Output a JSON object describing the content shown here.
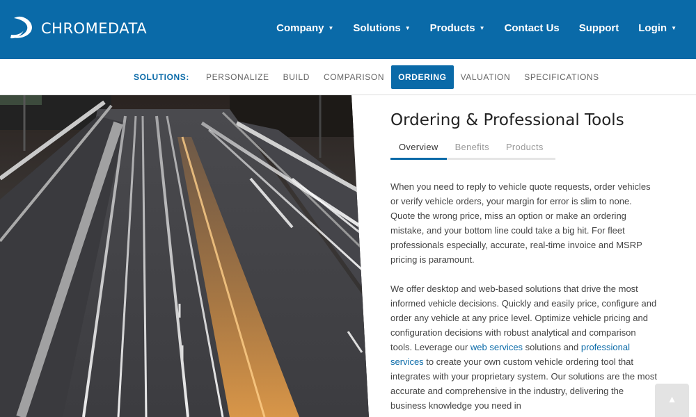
{
  "brand": {
    "name": "CHROMEDATA",
    "logo_icon": "chromedata-swoosh-logo",
    "primary_color": "#0a6aa8"
  },
  "nav": {
    "items": [
      {
        "label": "Company",
        "dropdown": true
      },
      {
        "label": "Solutions",
        "dropdown": true
      },
      {
        "label": "Products",
        "dropdown": true
      },
      {
        "label": "Contact Us",
        "dropdown": false
      },
      {
        "label": "Support",
        "dropdown": false
      },
      {
        "label": "Login",
        "dropdown": true
      }
    ],
    "caret": "▼"
  },
  "subnav": {
    "label": "SOLUTIONS:",
    "items": [
      "PERSONALIZE",
      "BUILD",
      "COMPARISON",
      "ORDERING",
      "VALUATION",
      "SPECIFICATIONS"
    ],
    "active": "ORDERING"
  },
  "main": {
    "title": "Ordering & Professional Tools",
    "tabs": [
      "Overview",
      "Benefits",
      "Products"
    ],
    "active_tab": "Overview",
    "p1": "When you need to reply to vehicle quote requests, order vehicles or verify vehicle orders, your margin for error is slim to none. Quote the wrong price, miss an option or make an ordering mistake, and your bottom line could take a big hit. For fleet professionals especially, accurate, real-time invoice and MSRP pricing is paramount.",
    "p2_a": "We offer desktop and web-based solutions that drive the most informed vehicle decisions. Quickly and easily price, configure and order any vehicle at any price level. Optimize vehicle pricing and configuration decisions with robust analytical and comparison tools. Leverage our ",
    "p2_link1": "web services",
    "p2_b": " solutions and ",
    "p2_link2": "professional services",
    "p2_c": " to create your own custom vehicle ordering tool that integrates with your proprietary system. Our solutions are the most accurate and comprehensive in the industry, delivering the business knowledge you need in"
  },
  "scroll_top": {
    "icon": "chevron-up-icon",
    "glyph": "▲"
  }
}
